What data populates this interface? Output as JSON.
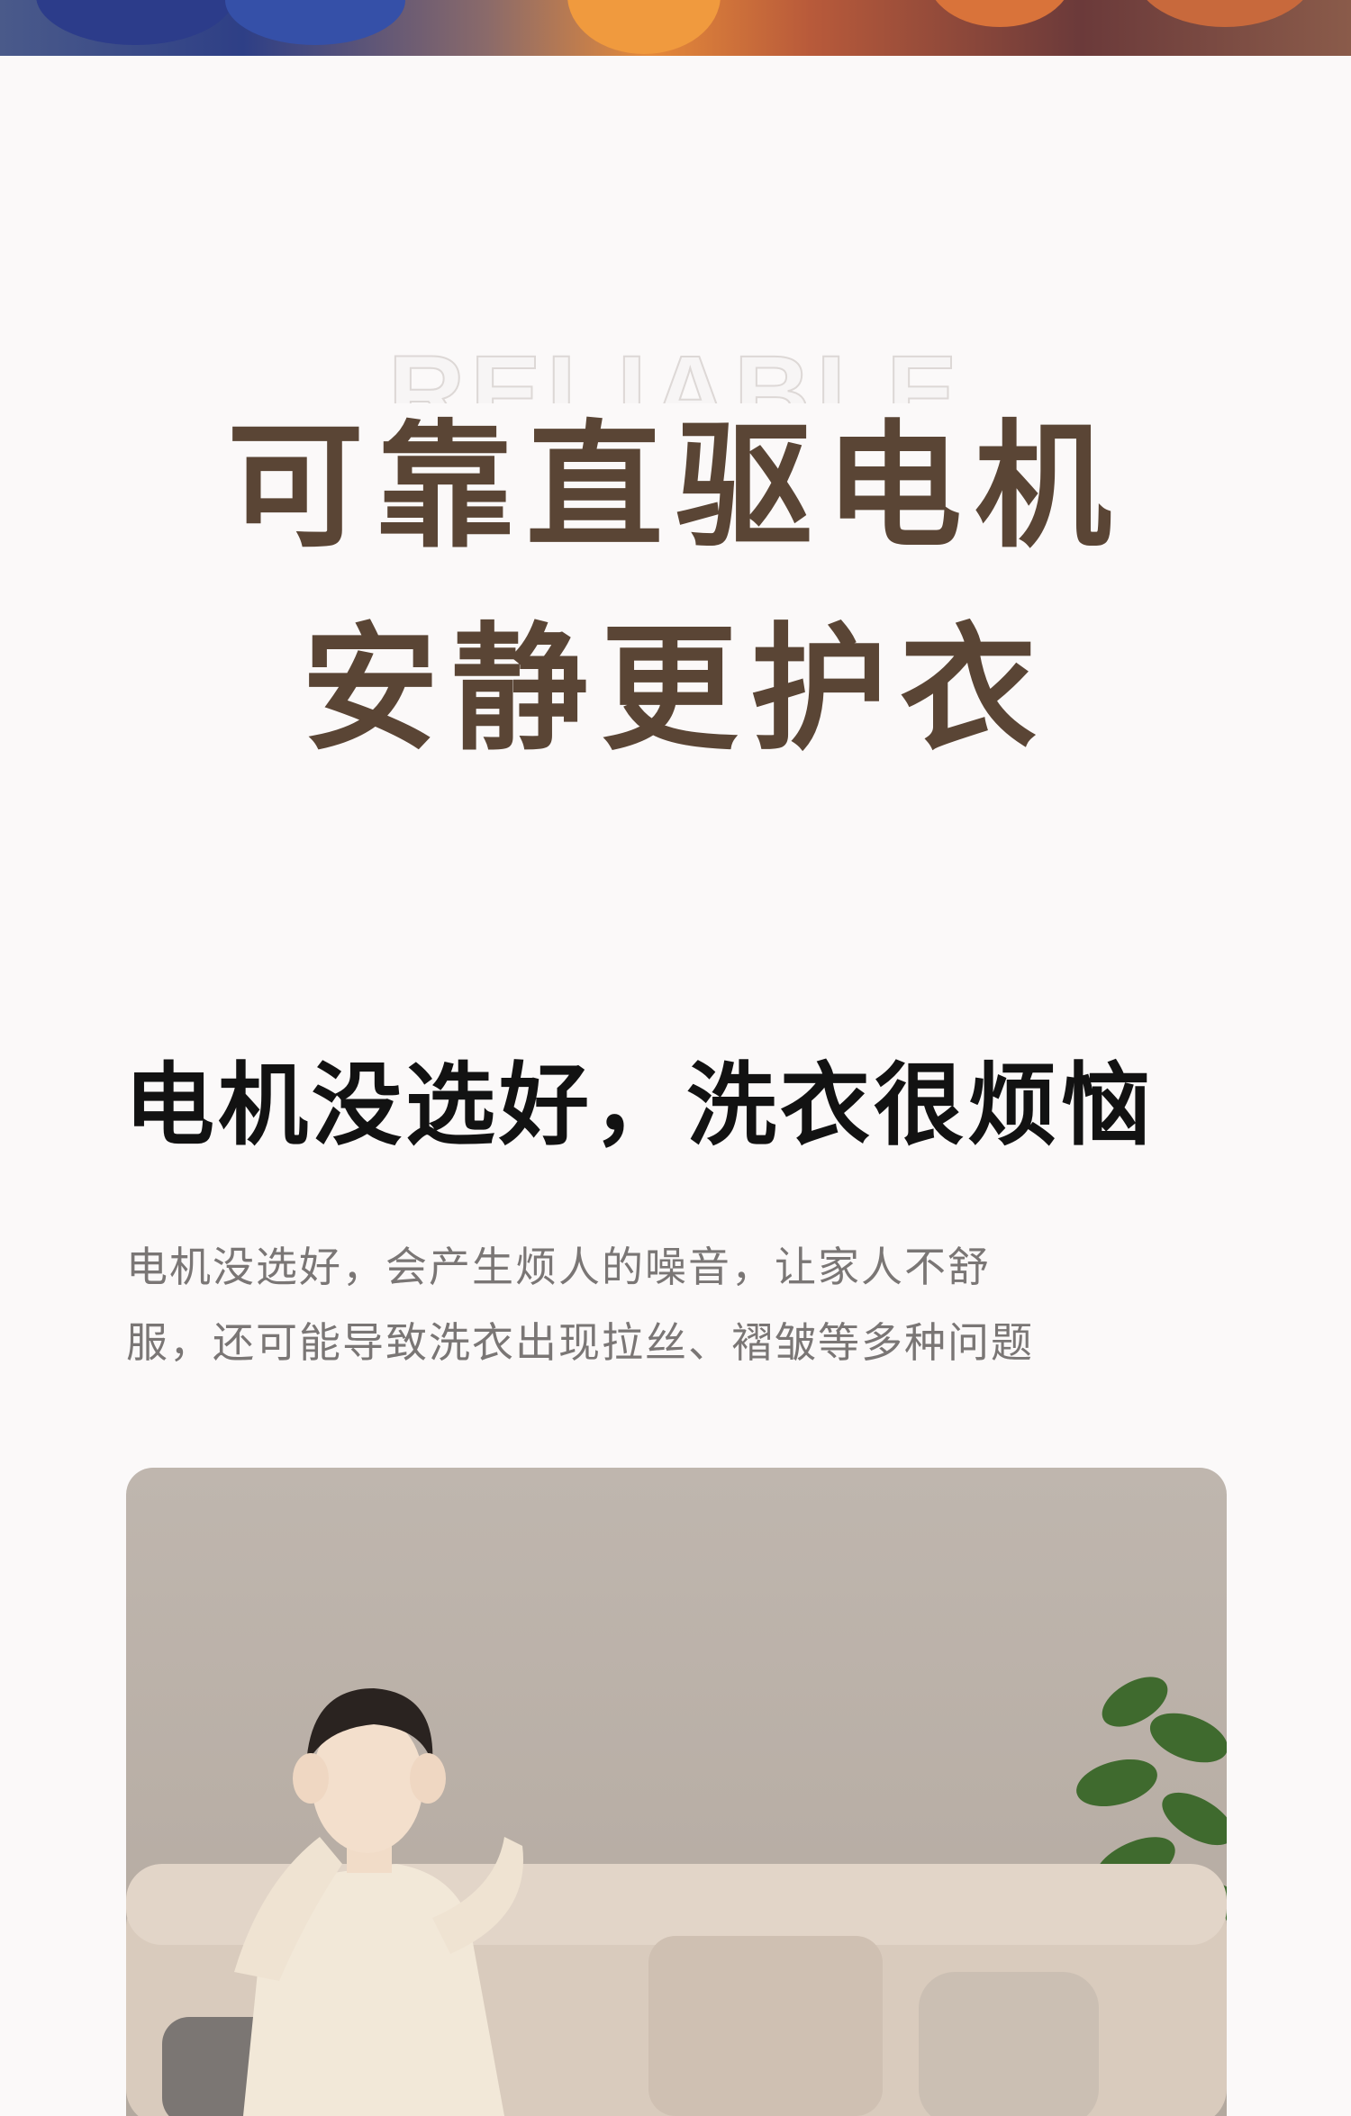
{
  "hero": {
    "colors": [
      "#2e3f86",
      "#e58a3a",
      "#6b3a3a"
    ]
  },
  "intro": {
    "eyebrow": "RELIABLE",
    "headline_line1": "可靠直驱电机",
    "headline_line2": "安静更护衣",
    "headline_color": "#5a4535"
  },
  "problem": {
    "title": "电机没选好，洗衣很烦恼",
    "description_line1": "电机没选好，会产生烦人的噪音，让家人不舒",
    "description_line2": "服，还可能导致洗衣出现拉丝、褶皱等多种问题"
  },
  "photo": {
    "subject": "woman-covering-ears-on-sofa"
  }
}
